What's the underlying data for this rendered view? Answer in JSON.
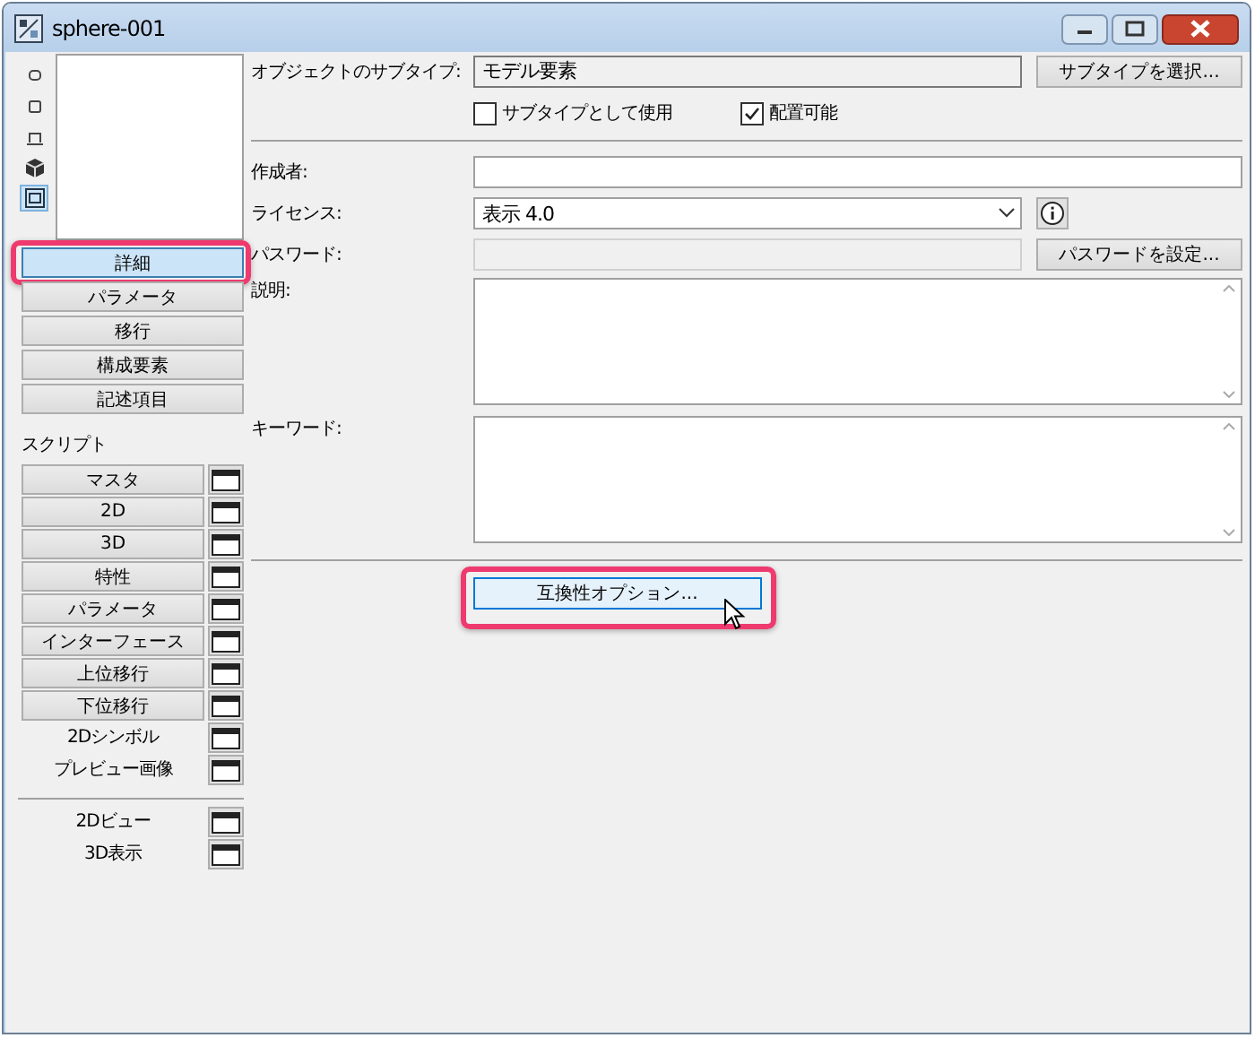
{
  "window": {
    "title": "sphere-001"
  },
  "view_icons": [
    {
      "kind": "outline",
      "selected": false
    },
    {
      "kind": "square",
      "selected": false
    },
    {
      "kind": "plan",
      "selected": false
    },
    {
      "kind": "cube",
      "selected": false
    },
    {
      "kind": "frame",
      "selected": true
    }
  ],
  "sections": [
    {
      "label": "詳細",
      "selected": true,
      "highlighted": true
    },
    {
      "label": "パラメータ",
      "selected": false,
      "highlighted": false
    },
    {
      "label": "移行",
      "selected": false,
      "highlighted": false
    },
    {
      "label": "構成要素",
      "selected": false,
      "highlighted": false
    },
    {
      "label": "記述項目",
      "selected": false,
      "highlighted": false
    }
  ],
  "scripts_label": "スクリプト",
  "scripts": [
    {
      "label": "マスタ",
      "kind": "button"
    },
    {
      "label": "2D",
      "kind": "button"
    },
    {
      "label": "3D",
      "kind": "button"
    },
    {
      "label": "特性",
      "kind": "button"
    },
    {
      "label": "パラメータ",
      "kind": "button"
    },
    {
      "label": "インターフェース",
      "kind": "button"
    },
    {
      "label": "上位移行",
      "kind": "button"
    },
    {
      "label": "下位移行",
      "kind": "button"
    },
    {
      "label": "2Dシンボル",
      "kind": "plain"
    },
    {
      "label": "プレビュー画像",
      "kind": "plain"
    }
  ],
  "views": [
    {
      "label": "2Dビュー"
    },
    {
      "label": "3D表示"
    }
  ],
  "form": {
    "subtype": {
      "label": "オブジェクトのサブタイプ:",
      "value": "モデル要素",
      "button": "サブタイプを選択..."
    },
    "checkboxes": [
      {
        "label": "サブタイプとして使用",
        "checked": false
      },
      {
        "label": "配置可能",
        "checked": true
      }
    ],
    "author": {
      "label": "作成者:"
    },
    "license": {
      "label": "ライセンス:",
      "value": "表示 4.0"
    },
    "password": {
      "label": "パスワード:",
      "disabled": true,
      "button": "パスワードを設定..."
    },
    "description": {
      "label": "説明:"
    },
    "keywords": {
      "label": "キーワード:"
    },
    "compat_button": {
      "label": "互換性オプション...",
      "highlighted": true,
      "hovered": true
    }
  }
}
